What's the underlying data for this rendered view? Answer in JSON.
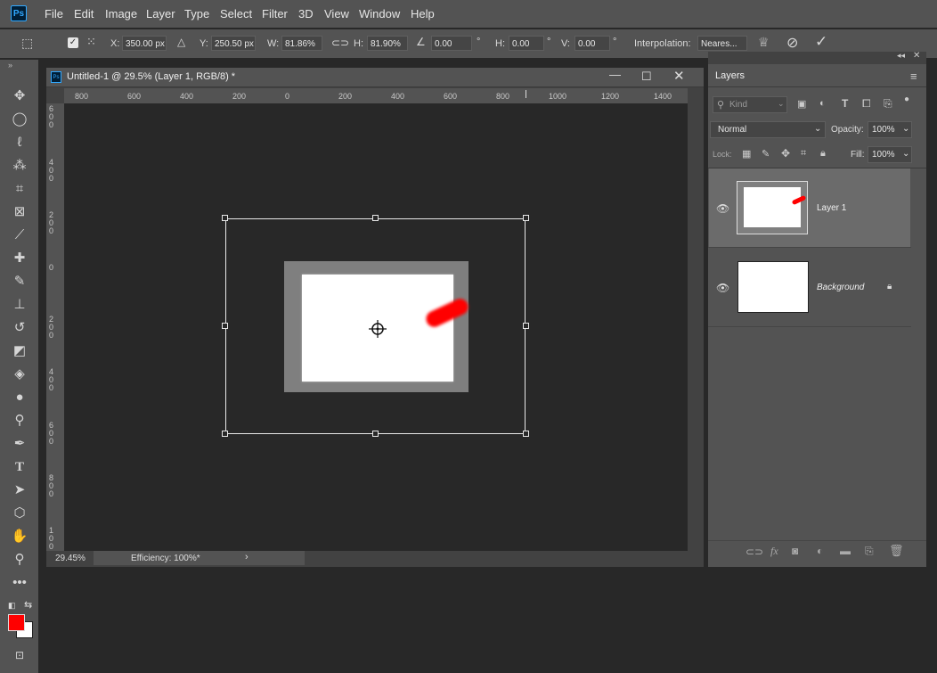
{
  "app": {
    "logo": "Ps"
  },
  "menu": [
    "File",
    "Edit",
    "Image",
    "Layer",
    "Type",
    "Select",
    "Filter",
    "3D",
    "View",
    "Window",
    "Help"
  ],
  "options": {
    "x_label": "X:",
    "x_value": "350.00 px",
    "y_label": "Y:",
    "y_value": "250.50 px",
    "w_label": "W:",
    "w_value": "81.86%",
    "h_label": "H:",
    "h_value": "81.90%",
    "angle_value": "0.00",
    "angle_unit": "°",
    "hskew_label": "H:",
    "hskew_value": "0.00",
    "hskew_unit": "°",
    "vskew_label": "V:",
    "vskew_value": "0.00",
    "vskew_unit": "°",
    "interp_label": "Interpolation:",
    "interp_value": "Neares..."
  },
  "document": {
    "title": "Untitled-1 @ 29.5% (Layer 1, RGB/8) *",
    "ruler_top": [
      "800",
      "600",
      "400",
      "200",
      "0",
      "200",
      "400",
      "600",
      "800",
      "1000",
      "1200",
      "1400"
    ],
    "ruler_left": [
      "6\n0\n0",
      "4\n0\n0",
      "2\n0\n0",
      "0",
      "2\n0\n0",
      "4\n0\n0",
      "6\n0\n0",
      "8\n0\n0",
      "1\n0\n0"
    ],
    "zoom": "29.45%",
    "status": "Efficiency: 100%*"
  },
  "layers_panel": {
    "tab": "Layers",
    "filter_placeholder": "Kind",
    "blend_mode": "Normal",
    "opacity_label": "Opacity:",
    "opacity_value": "100%",
    "lock_label": "Lock:",
    "fill_label": "Fill:",
    "fill_value": "100%",
    "layers": [
      {
        "name": "Layer 1",
        "selected": true
      },
      {
        "name": "Background",
        "locked": true
      }
    ]
  },
  "colors": {
    "foreground": "#ff0000",
    "background": "#ffffff",
    "accent": "#31a8ff"
  }
}
